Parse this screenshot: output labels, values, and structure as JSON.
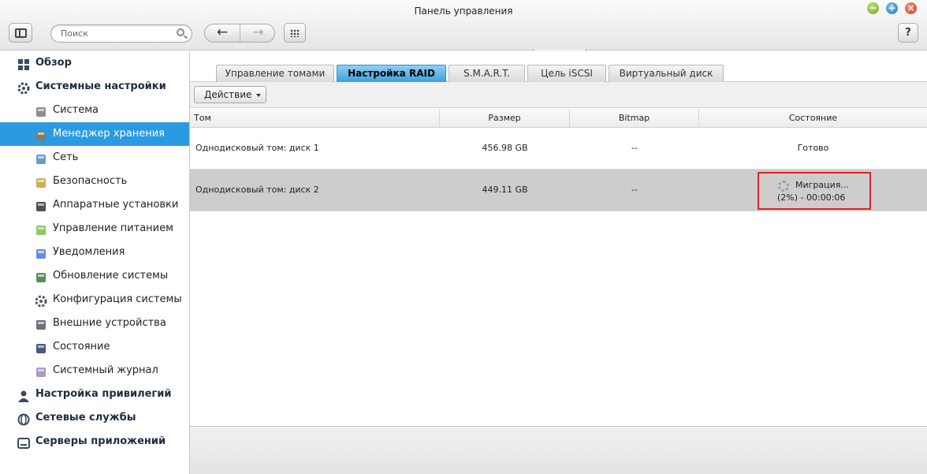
{
  "window": {
    "title": "Панель управления"
  },
  "toolbar": {
    "search_placeholder": "Поиск",
    "help_label": "?"
  },
  "sidebar": {
    "items": [
      {
        "label": "Обзор",
        "level": "top",
        "icon": "overview-icon"
      },
      {
        "label": "Системные настройки",
        "level": "top",
        "icon": "settings-gear-icon"
      },
      {
        "label": "Система",
        "level": "sub",
        "icon": "system-icon"
      },
      {
        "label": "Менеджер хранения",
        "level": "sub",
        "icon": "storage-icon",
        "active": true
      },
      {
        "label": "Сеть",
        "level": "sub",
        "icon": "network-icon"
      },
      {
        "label": "Безопасность",
        "level": "sub",
        "icon": "lock-icon"
      },
      {
        "label": "Аппаратные установки",
        "level": "sub",
        "icon": "hardware-icon"
      },
      {
        "label": "Управление питанием",
        "level": "sub",
        "icon": "power-bulb-icon"
      },
      {
        "label": "Уведомления",
        "level": "sub",
        "icon": "notification-icon"
      },
      {
        "label": "Обновление системы",
        "level": "sub",
        "icon": "update-icon"
      },
      {
        "label": "Конфигурация системы",
        "level": "sub",
        "icon": "config-gear-icon"
      },
      {
        "label": "Внешние устройства",
        "level": "sub",
        "icon": "external-device-icon"
      },
      {
        "label": "Состояние",
        "level": "sub",
        "icon": "monitor-icon"
      },
      {
        "label": "Системный журнал",
        "level": "sub",
        "icon": "log-icon"
      },
      {
        "label": "Настройка привилегий",
        "level": "top",
        "icon": "user-icon"
      },
      {
        "label": "Сетевые службы",
        "level": "top",
        "icon": "globe-icon"
      },
      {
        "label": "Серверы приложений",
        "level": "top",
        "icon": "app-server-icon"
      }
    ]
  },
  "tabs": [
    {
      "label": "Управление томами"
    },
    {
      "label": "Настройка RAID",
      "active": true
    },
    {
      "label": "S.M.A.R.T."
    },
    {
      "label": "Цель iSCSI"
    },
    {
      "label": "Виртуальный диск"
    }
  ],
  "action": {
    "label": "Действие"
  },
  "table": {
    "columns": [
      "Том",
      "Размер",
      "Bitmap",
      "Состояние"
    ],
    "rows": [
      {
        "volume": "Однодисковый том: диск 1",
        "size": "456.98 GB",
        "bitmap": "--",
        "status": "Готово"
      },
      {
        "volume": "Однодисковый том: диск 2",
        "size": "449.11 GB",
        "bitmap": "--",
        "status_line1": "Миграция...",
        "status_line2": "(2%) - 00:00:06",
        "selected": true
      }
    ]
  },
  "colors": {
    "accent": "#2b9ae0",
    "tab_active": "#3b9fdd",
    "highlight_box": "#e02222"
  }
}
